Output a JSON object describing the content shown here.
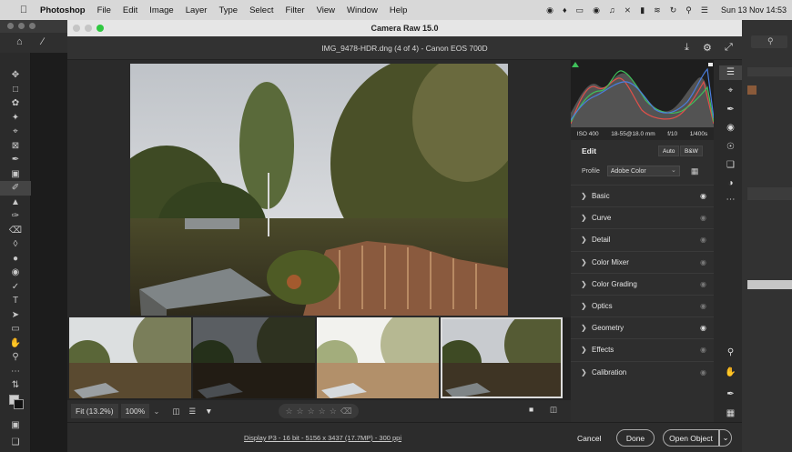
{
  "menubar": {
    "app_name": "Photoshop",
    "items": [
      "File",
      "Edit",
      "Image",
      "Layer",
      "Type",
      "Select",
      "Filter",
      "View",
      "Window",
      "Help"
    ],
    "clock": "Sun 13 Nov 14:53"
  },
  "window": {
    "title": "Camera Raw 15.0",
    "filename": "IMG_9478-HDR.dng (4 of 4)  -  Canon EOS 700D"
  },
  "exif": {
    "iso": "ISO 400",
    "lens": "18-55@18.0 mm",
    "aperture": "f/10",
    "shutter": "1/400s"
  },
  "edit": {
    "title": "Edit",
    "auto_label": "Auto",
    "bw_label": "B&W",
    "profile_label": "Profile",
    "profile_value": "Adobe Color",
    "sections": [
      {
        "label": "Basic",
        "eye_on": true
      },
      {
        "label": "Curve",
        "eye_on": false
      },
      {
        "label": "Detail",
        "eye_on": false
      },
      {
        "label": "Color Mixer",
        "eye_on": false
      },
      {
        "label": "Color Grading",
        "eye_on": false
      },
      {
        "label": "Optics",
        "eye_on": false
      },
      {
        "label": "Geometry",
        "eye_on": true
      },
      {
        "label": "Effects",
        "eye_on": false
      },
      {
        "label": "Calibration",
        "eye_on": false
      }
    ]
  },
  "statusbar": {
    "fit_label": "Fit (13.2%)",
    "zoom_value": "100%",
    "stars": 0
  },
  "footer": {
    "info": "Display P3 - 16 bit - 5156 x 3437 (17.7MP) - 300 ppi",
    "cancel_label": "Cancel",
    "done_label": "Done",
    "open_label": "Open Object"
  },
  "filmstrip": {
    "count": 4,
    "selected_index": 3
  },
  "colors": {
    "accent_selected": "#dddddd",
    "panel_bg": "#2e2e2e"
  }
}
